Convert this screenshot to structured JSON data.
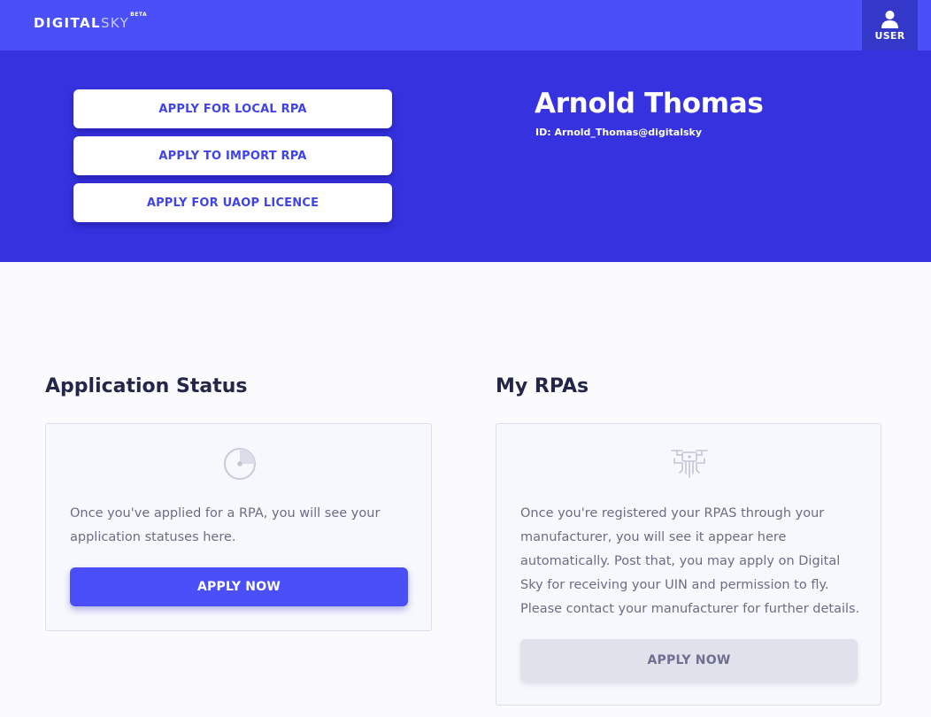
{
  "brand": {
    "digital": "DIGITAL",
    "sky": "SKY",
    "badge": "BETA"
  },
  "user_menu": {
    "label": "USER",
    "icon": "user-icon"
  },
  "hero": {
    "actions": [
      {
        "label": "APPLY FOR LOCAL RPA"
      },
      {
        "label": "APPLY TO IMPORT RPA"
      },
      {
        "label": "APPLY FOR UAOP LICENCE"
      }
    ],
    "profile": {
      "name": "Arnold Thomas",
      "id_text": "ID: Arnold_Thomas@digitalsky"
    }
  },
  "application_status": {
    "title": "Application Status",
    "icon": "pie-chart-icon",
    "description": "Once you've applied for a RPA, you will see your application statuses here.",
    "button": "APPLY NOW"
  },
  "my_rpas": {
    "title": "My RPAs",
    "icon": "drone-icon",
    "description": "Once you're registered your RPAS through your manufacturer, you will see it appear here automatically. Post that, you may apply on Digital Sky for receiving your UIN and permission to fly. Please contact your manufacturer for further details.",
    "button": "APPLY NOW"
  },
  "colors": {
    "topbar": "#4a4ff8",
    "hero": "#3632e0",
    "user_button": "#3438c9",
    "primary_button": "#4a4ff8",
    "disabled_button": "#e0e1ea"
  }
}
